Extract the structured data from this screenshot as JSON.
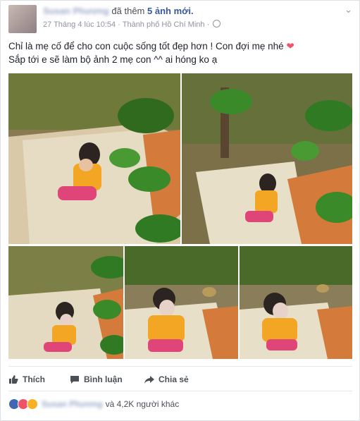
{
  "post": {
    "author": "Susan Phương",
    "action": "đã thêm",
    "count": "5 ảnh mới.",
    "timestamp": "27 Tháng 4 lúc 10:54 · Thành phố Hồ Chí Minh ·",
    "text_line1": "Chỉ là mẹ cố để cho con cuộc sống tốt đẹp hơn ! Con đợi mẹ nhé",
    "text_line1_icon": "heart-icon",
    "text_line2": "Sắp tới e sẽ làm bộ ảnh 2 mẹ con ^^ ai hóng ko ạ",
    "menu_icon": "chevron-down-icon"
  },
  "photos": [
    {
      "name": "photo-1"
    },
    {
      "name": "photo-2"
    },
    {
      "name": "photo-3"
    },
    {
      "name": "photo-4"
    },
    {
      "name": "photo-5"
    }
  ],
  "actions": {
    "like": "Thích",
    "comment": "Bình luận",
    "share": "Chia sẻ"
  },
  "reactions": {
    "icons": [
      "like-icon",
      "love-icon",
      "sad-icon"
    ],
    "name": "Susan Phương",
    "others": "và 4,2K người khác"
  },
  "colors": {
    "link": "#365899",
    "meta": "#90949c",
    "heart": "#f25268",
    "like": "#4267b2"
  }
}
